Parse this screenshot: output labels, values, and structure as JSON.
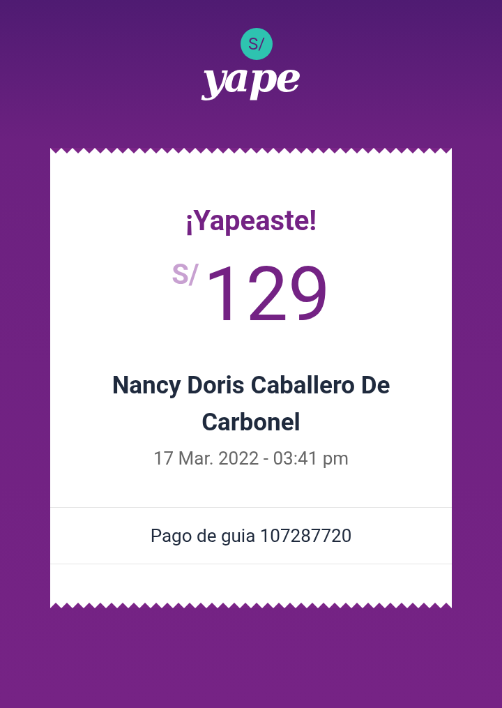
{
  "logo": {
    "badge": "S/",
    "wordmark": "yape"
  },
  "receipt": {
    "title": "¡Yapeaste!",
    "currency": "S/",
    "amount": "129",
    "recipient": "Nancy Doris Caballero De Carbonel",
    "datetime": "17 Mar. 2022 - 03:41 pm",
    "memo": "Pago de guia 107287720"
  }
}
